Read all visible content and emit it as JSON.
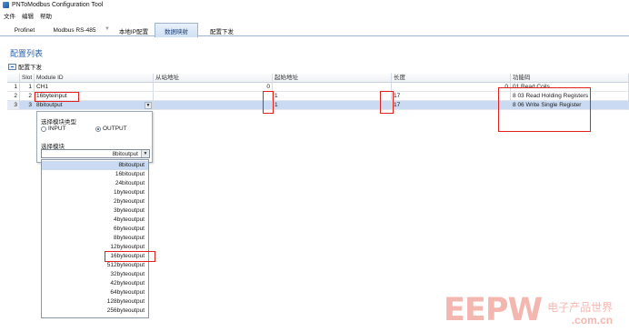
{
  "window": {
    "title": "PNToModbus Configuration Tool"
  },
  "menu": [
    "文件",
    "编辑",
    "帮助"
  ],
  "tabs": [
    "Profinet",
    "Modbus RS-485",
    "本地IP配置",
    "数据映射",
    "配置下发"
  ],
  "active_tab": "数据映射",
  "section_title": "配置列表",
  "toolbar": {
    "download_label": "配置下发"
  },
  "grid": {
    "columns": [
      "",
      "Slot",
      "Module ID",
      "从站地址",
      "起始地址",
      "长度",
      "功能码"
    ],
    "rows": [
      {
        "row": "1",
        "slot": "1",
        "module": "CH1",
        "slave": "0",
        "start": "",
        "length": "0",
        "func_num": "",
        "func": "01 Read Coils"
      },
      {
        "row": "2",
        "slot": "2",
        "module": "16byteinput",
        "slave": "",
        "start": "1",
        "length": "17",
        "func_num": "8",
        "func": "03 Read Holding Registers"
      },
      {
        "row": "3",
        "slot": "3",
        "module": "8bitoutput",
        "slave": "",
        "start": "1",
        "length": "17",
        "func_num": "8",
        "func": "06 Write Single Register"
      }
    ]
  },
  "popup": {
    "type_label": "选择模块类型",
    "input_label": "INPUT",
    "output_label": "OUTPUT",
    "selected_type": "OUTPUT",
    "module_label": "选择模块",
    "combo_value": "8bitoutput"
  },
  "dropdown_options": [
    "8bitoutput",
    "16bitoutput",
    "24bitoutput",
    "1byteoutput",
    "2byteoutput",
    "3byteoutput",
    "4byteoutput",
    "6byteoutput",
    "8byteoutput",
    "12byteoutput",
    "16byteoutput",
    "512byteoutput",
    "32byteoutput",
    "42byteoutput",
    "64byteoutput",
    "128byteoutput",
    "256byteoutput"
  ],
  "dropdown_highlighted": "8bitoutput",
  "watermark": {
    "logo": "EEPW",
    "cn": "电子产品世界",
    "url": ".com.cn"
  },
  "colors": {
    "selection": "#c9daf2",
    "accent": "#2c61a8",
    "annotation_red": "#e0221f"
  }
}
